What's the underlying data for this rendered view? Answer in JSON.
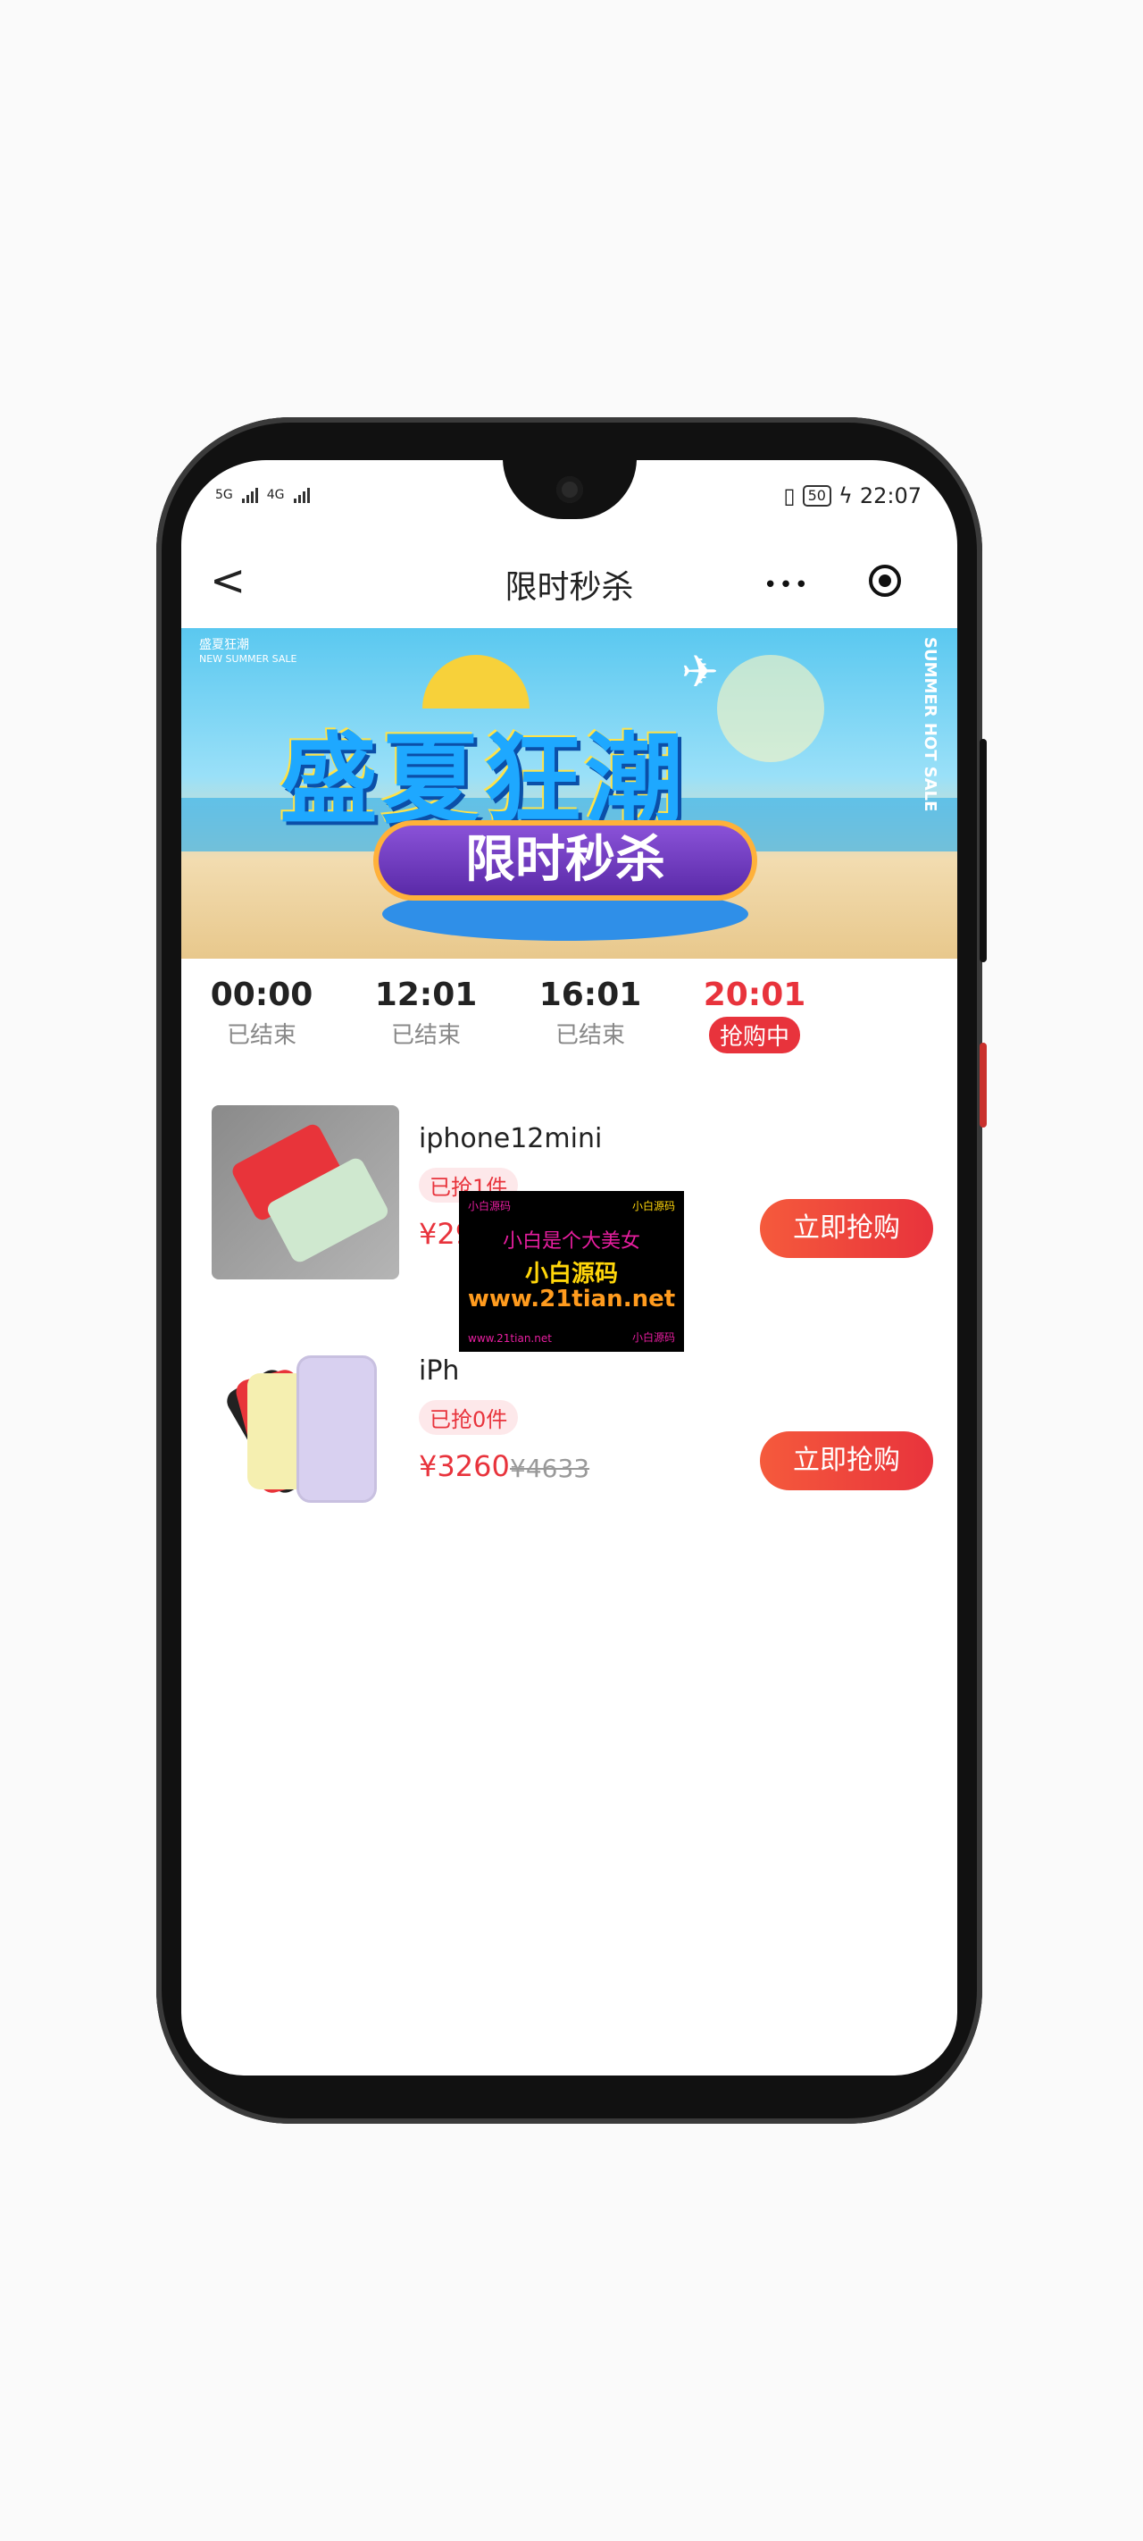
{
  "status": {
    "time": "22:07",
    "battery": "50",
    "net_left": "5G",
    "net_right": "4G"
  },
  "nav": {
    "back": "<",
    "title": "限时秒杀",
    "more": "•••"
  },
  "banner": {
    "tag": "盛夏狂潮",
    "tag_en": "NEW SUMMER SALE",
    "headline": "盛夏狂潮",
    "subline": "限时秒杀",
    "side": "SUMMER HOT SALE"
  },
  "tabs": [
    {
      "time": "00:00",
      "status": "已结束"
    },
    {
      "time": "12:01",
      "status": "已结束"
    },
    {
      "time": "16:01",
      "status": "已结束"
    },
    {
      "time": "20:01",
      "status": "抢购中"
    }
  ],
  "products": [
    {
      "name": "iphone12mini",
      "sold": "已抢1件",
      "price": "¥29",
      "buy_label": "立即抢购"
    },
    {
      "name": "iPh",
      "sold": "已抢0件",
      "price": "¥3260",
      "orig_price": "¥4633",
      "buy_label": "立即抢购"
    }
  ],
  "watermark": {
    "line1": "小白源码",
    "line2": "小白源码",
    "line3": "小白是个大美女",
    "line4": "小白源码",
    "line5": "www.21tian.net",
    "line6": "www.21tian.net",
    "line7": "小白源码"
  }
}
